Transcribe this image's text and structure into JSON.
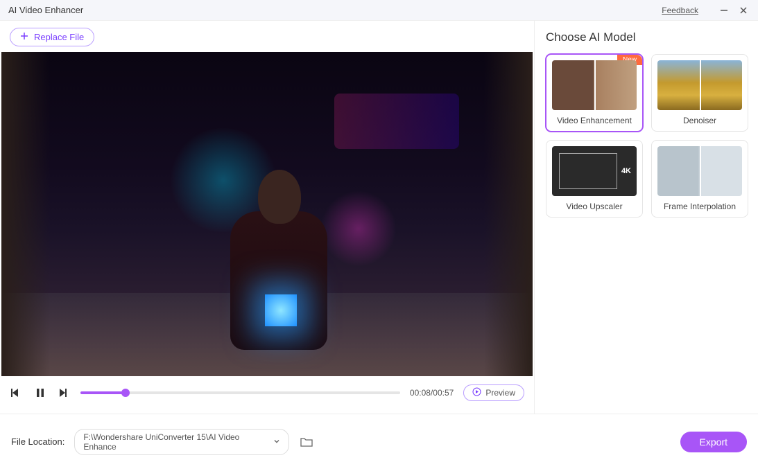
{
  "titlebar": {
    "title": "AI Video Enhancer",
    "feedback": "Feedback"
  },
  "toolbar": {
    "replace_label": "Replace File"
  },
  "player": {
    "time": "00:08/00:57",
    "preview_label": "Preview",
    "progress_pct": 14
  },
  "sidebar": {
    "heading": "Choose AI Model",
    "models": [
      {
        "label": "Video Enhancement",
        "badge": "New",
        "selected": true
      },
      {
        "label": "Denoiser"
      },
      {
        "label": "Video Upscaler"
      },
      {
        "label": "Frame Interpolation"
      }
    ]
  },
  "footer": {
    "location_label": "File Location:",
    "location_value": "F:\\Wondershare UniConverter 15\\AI Video Enhance",
    "export_label": "Export"
  }
}
